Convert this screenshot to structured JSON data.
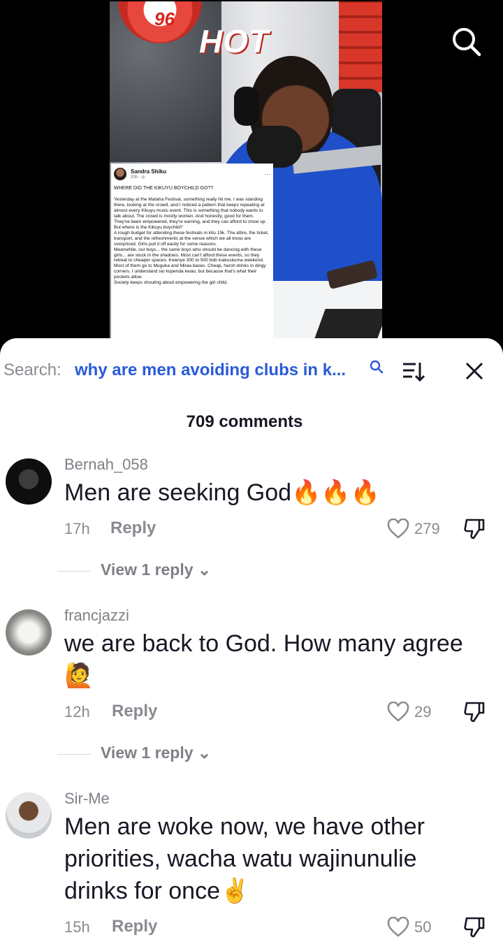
{
  "video": {
    "station_text": "HOT",
    "logo_text": "96",
    "post": {
      "author": "Sandra Shiku",
      "time": "20h · ",
      "more": "···",
      "title": "WHERE DID THE KIKUYU BOYCHILD GO??",
      "body": "Yesterday at the Mataha Festival, something really hit me. I was standing there, looking at the crowd, and I noticed a pattern that keeps repeating at almost every Kikuyu music event. This is something that nobody wants to talk about. The crowd is mostly women. And honestly, good for them. They've been empowered, they're earning, and they can afford to show up.\nBut where is the Kikuyu boychild?\nA rough budget for attending these festivals ni kitu 15k. The attire, the ticket, transport, and the refreshments at the venue which we all know are overpriced. Girls pull it off easily for some reasons.\nMeanwhile, our boys... the same boys who should be dancing with these girls... are stuck in the shadows. Most can't afford these events, so they retreat to cheaper spaces. Kwenye 300 to 500 bob inakuskuma weekend. Most of them go to Muguka and Miraa bases. Cheap, harsh drinks in dingy corners. I understand sio kupenda kwao, but because that's what their pockets allow.\nSociety keeps shouting about empowering the girl child,"
    }
  },
  "search": {
    "label": "Search:",
    "query": "why are men avoiding clubs in k...",
    "icon": "search-icon"
  },
  "comments_count": "709 comments",
  "comments": [
    {
      "username": "Bernah_058",
      "text": "Men are seeking God🔥🔥🔥",
      "time": "17h",
      "reply_label": "Reply",
      "likes": "279",
      "view_replies": "View 1 reply ⌄"
    },
    {
      "username": "francjazzi",
      "text": "we are back to God. How many agree 🙋",
      "time": "12h",
      "reply_label": "Reply",
      "likes": "29",
      "view_replies": "View 1 reply ⌄"
    },
    {
      "username": "Sir-Me",
      "text": "Men are woke now, we have other priorities, wacha watu wajinunulie drinks for once✌️",
      "time": "15h",
      "reply_label": "Reply",
      "likes": "50"
    }
  ],
  "colors": {
    "accent": "#2a5bd7",
    "muted": "#8a8b91",
    "text": "#161823"
  }
}
